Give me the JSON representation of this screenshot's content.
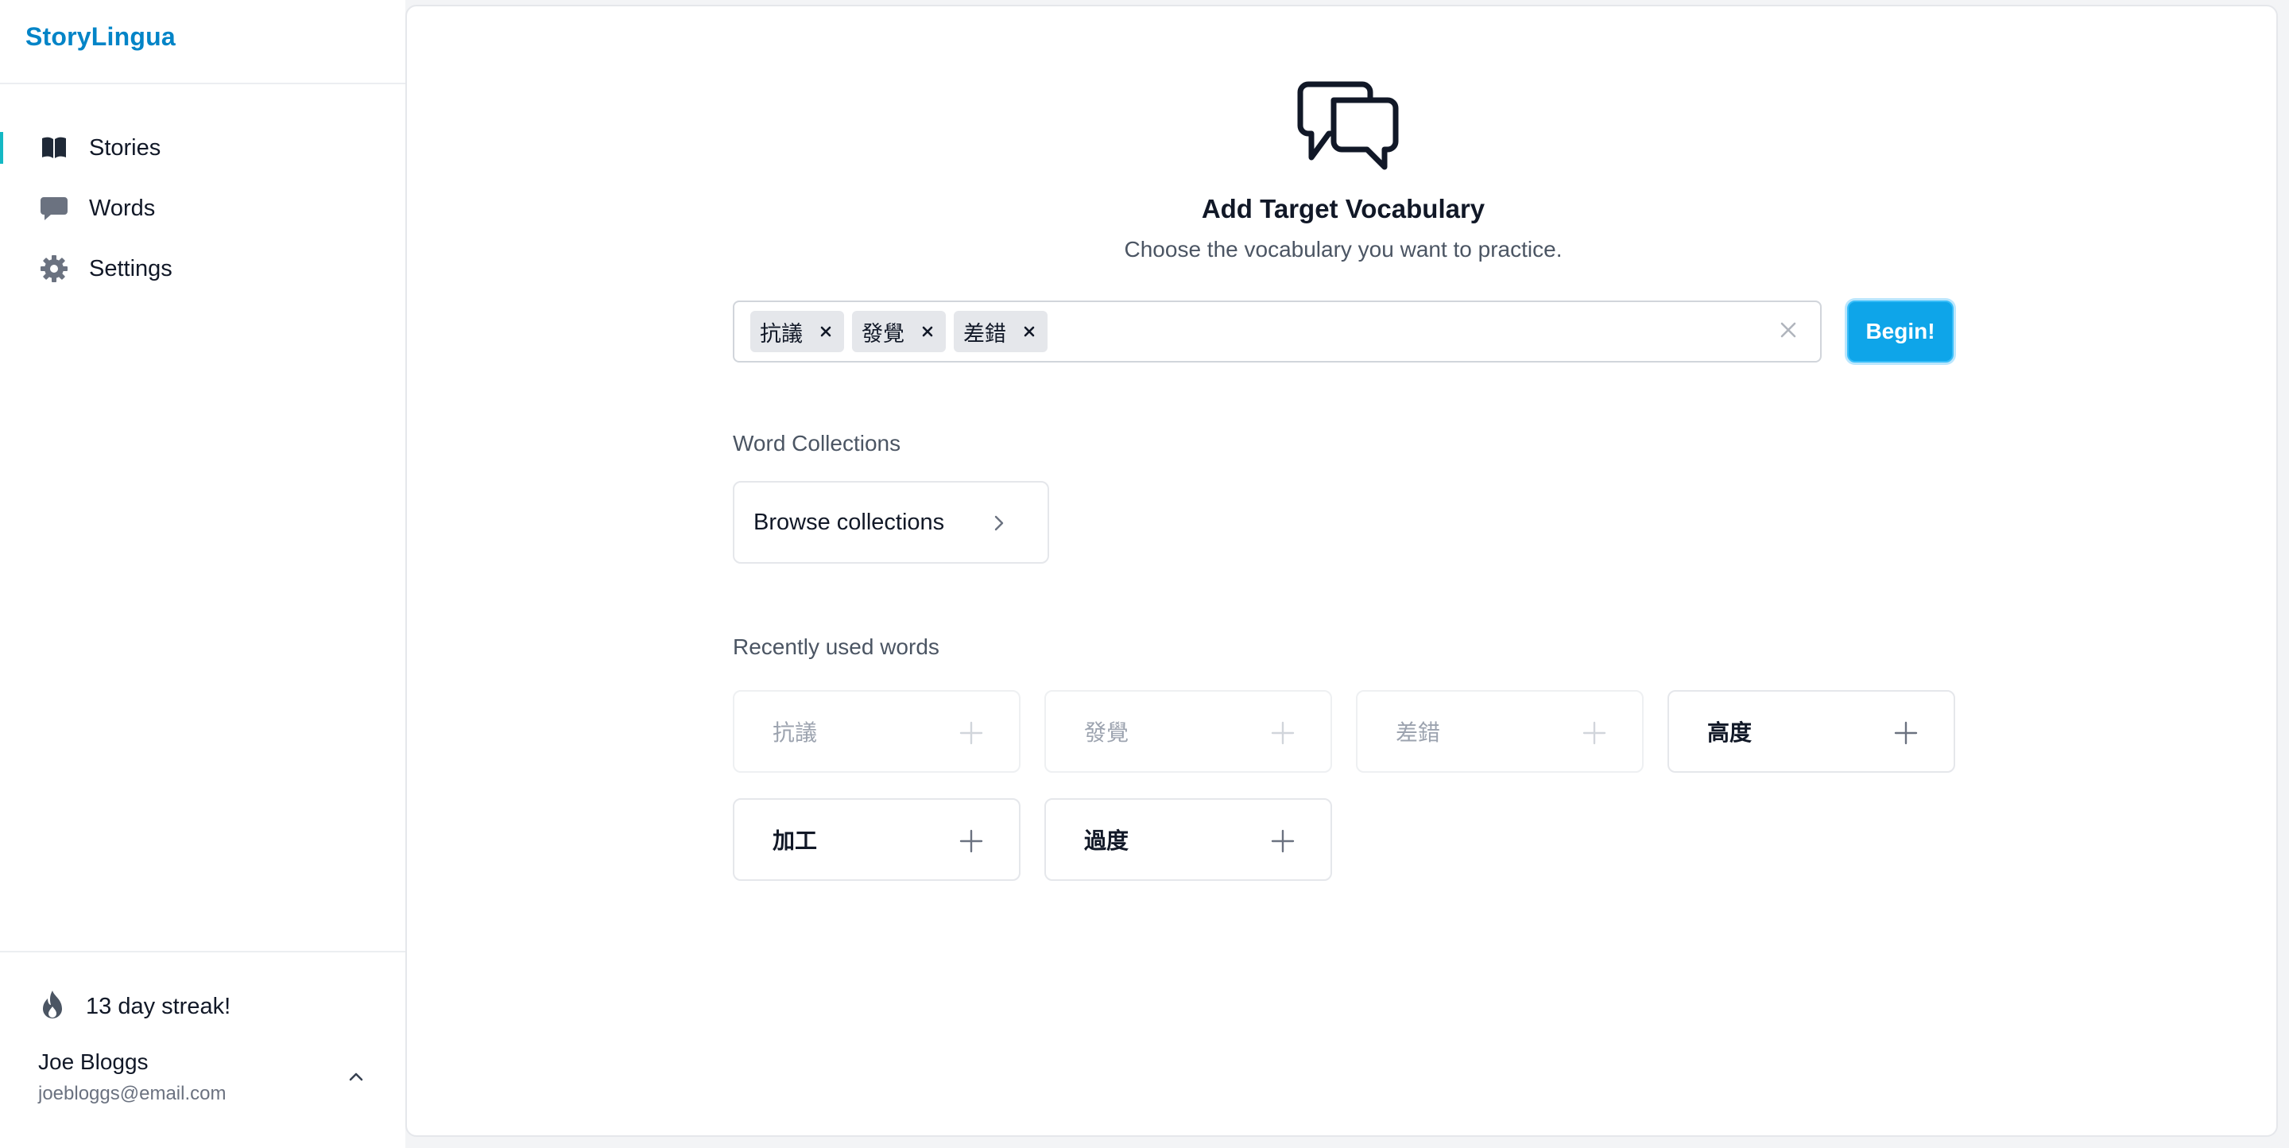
{
  "app": {
    "brand": "StoryLingua",
    "accent_color": "#0284c7",
    "active_indicator_color": "#14b8c4"
  },
  "sidebar": {
    "items": [
      {
        "label": "Stories",
        "icon": "open-book-icon",
        "active": true
      },
      {
        "label": "Words",
        "icon": "speech-bubble-icon",
        "active": false
      },
      {
        "label": "Settings",
        "icon": "gear-icon",
        "active": false
      }
    ],
    "streak": {
      "label": "13 day streak!",
      "icon": "flame-icon"
    },
    "user": {
      "name": "Joe Bloggs",
      "email": "joebloggs@email.com",
      "toggle_icon": "chevron-up-icon"
    }
  },
  "main": {
    "hero": {
      "icon": "chat-bubbles-icon",
      "title": "Add Target Vocabulary",
      "subtitle": "Choose the vocabulary you want to practice."
    },
    "vocab_input": {
      "chips": [
        {
          "label": "抗議"
        },
        {
          "label": "發覺"
        },
        {
          "label": "差錯"
        }
      ],
      "value": "",
      "clear_icon": "close-icon"
    },
    "begin_button": {
      "label": "Begin!",
      "color": "#0ea5e9"
    },
    "collections": {
      "heading": "Word Collections",
      "browse_label": "Browse collections"
    },
    "recent": {
      "heading": "Recently used words",
      "words": [
        {
          "label": "抗議",
          "already_added": true
        },
        {
          "label": "發覺",
          "already_added": true
        },
        {
          "label": "差錯",
          "already_added": true
        },
        {
          "label": "高度",
          "already_added": false
        },
        {
          "label": "加工",
          "already_added": false
        },
        {
          "label": "過度",
          "already_added": false
        }
      ]
    }
  }
}
